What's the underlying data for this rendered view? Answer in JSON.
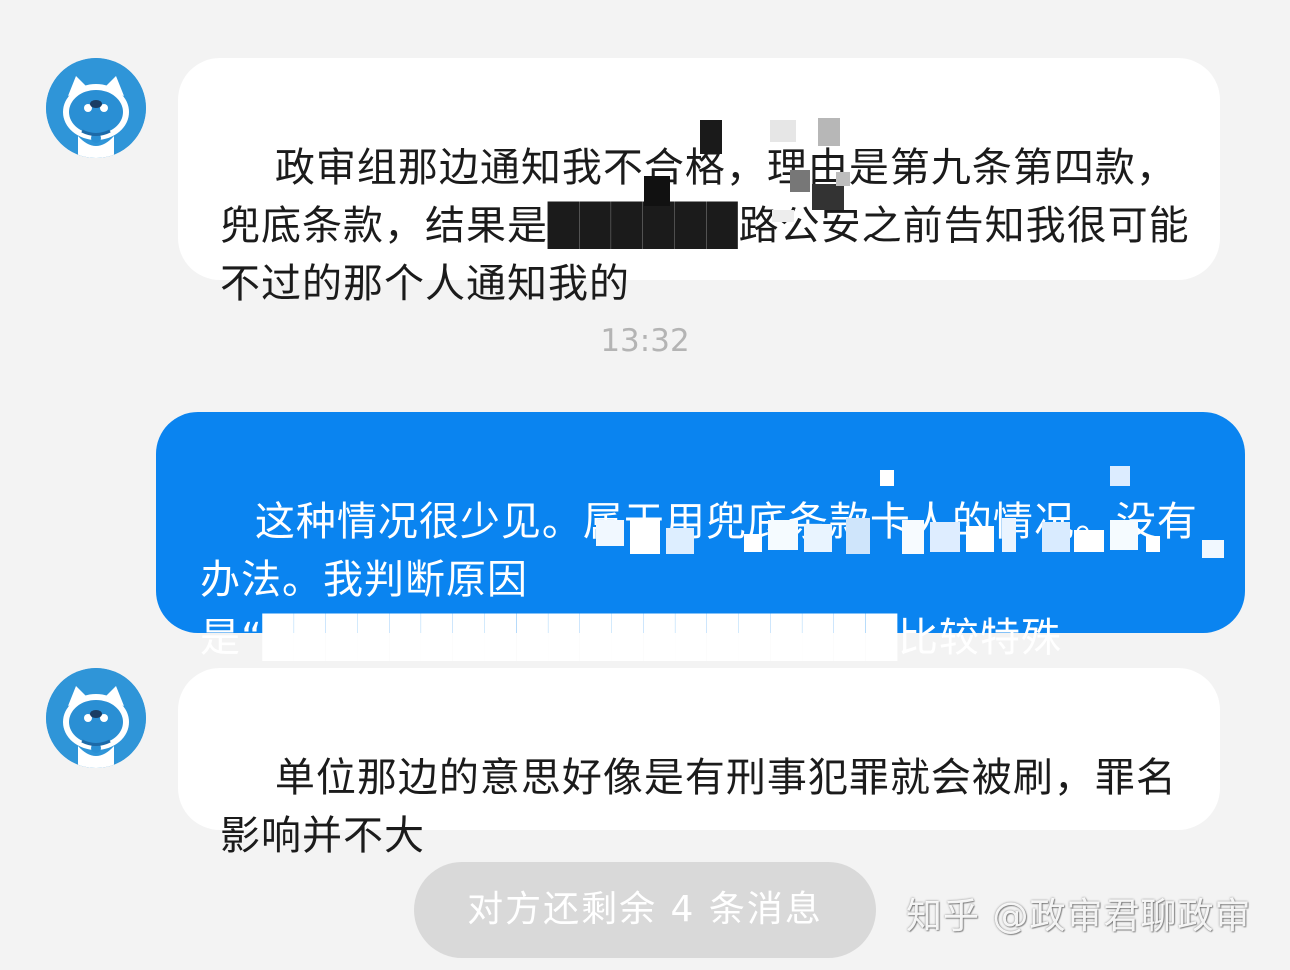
{
  "conversation": {
    "messages": [
      {
        "sender": "other",
        "avatar_icon": "bear-mascot-icon",
        "text": "政审组那边通知我不合格，理由是第九条第四款，兜底条款，结果是██████路公安之前告知我很可能不过的那个人通知我的"
      },
      {
        "sender": "me",
        "text": "这种情况很少见。属于用兜底条款卡人的情况。没有办法。我判断原因是“████████████████████比较特殊"
      },
      {
        "sender": "other",
        "avatar_icon": "bear-mascot-icon",
        "text": "单位那边的意思好像是有刑事犯罪就会被刷，罪名影响并不大"
      }
    ],
    "timestamp": "13:32"
  },
  "footer": {
    "remaining_messages": "对方还剩余 4 条消息",
    "watermark": "知乎 @政审君聊政审"
  },
  "colors": {
    "background": "#f3f3f3",
    "incoming_bubble": "#ffffff",
    "outgoing_bubble": "#0a84f0",
    "avatar": "#2f95d8",
    "pill": "#d9d9d9"
  }
}
